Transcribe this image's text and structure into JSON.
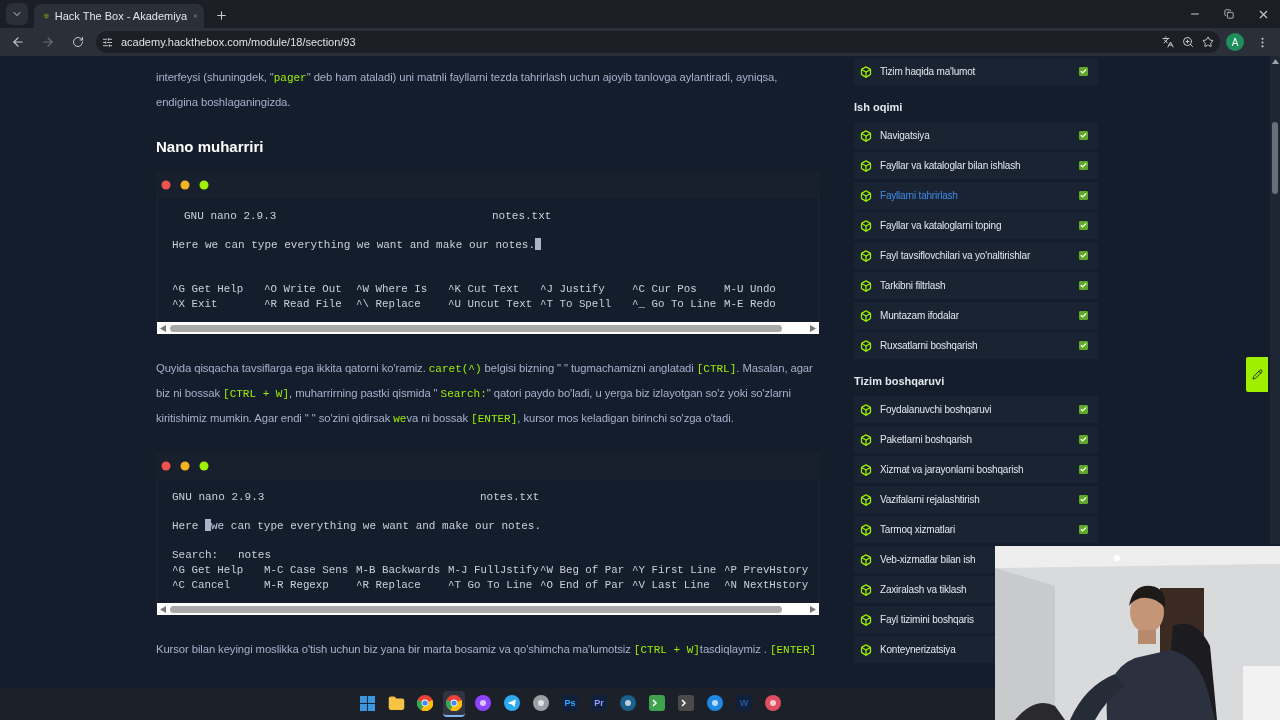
{
  "browser": {
    "tab": {
      "title": "Hack The Box - Akademiya",
      "selected": true
    },
    "url": "academy.hackthebox.com/module/18/section/93",
    "profile_initial": "A"
  },
  "article": [
    {
      "kind": "paragraph",
      "segments": [
        {
          "text": "interfeysi (shuningdek, \""
        },
        {
          "text": "pager",
          "kind": "code"
        },
        {
          "text": "\" deb ham ataladi) uni matnli fayllarni tezda tahrirlash uchun ajoyib tanlovga aylantiradi, ayniqsa, endigina boshlaganingizda."
        }
      ]
    },
    {
      "kind": "heading",
      "text": "Nano muharriri"
    },
    {
      "kind": "terminal",
      "lines": [
        {
          "kind": "title",
          "left": "GNU nano 2.9.3",
          "right": "notes.txt",
          "indented": true
        },
        {
          "kind": "text",
          "text": "Here we can type everything we want and make our notes.",
          "cursor": true
        },
        {
          "kind": "menu",
          "cells": [
            "^G Get Help",
            "^O Write Out",
            "^W Where Is",
            "^K Cut Text",
            "^J Justify",
            "^C Cur Pos",
            "M-U Undo"
          ]
        },
        {
          "kind": "menu",
          "cells": [
            "^X Exit",
            "^R Read File",
            "^\\ Replace",
            "^U Uncut Text",
            "^T To Spell",
            "^_ Go To Line",
            "M-E Redo"
          ]
        }
      ]
    },
    {
      "kind": "paragraph",
      "segments": [
        {
          "text": "Quyida qisqacha tavsiflarga ega ikkita qatorni ko'ramiz. "
        },
        {
          "text": "caret(^)",
          "kind": "code"
        },
        {
          "text": " belgisi bizning \" \" tugmachamizni anglatadi "
        },
        {
          "text": "[CTRL]",
          "kind": "code"
        },
        {
          "text": ". Masalan, agar biz ni bossak "
        },
        {
          "text": "[CTRL + W]",
          "kind": "code"
        },
        {
          "text": ", muharrirning pastki qismida \" "
        },
        {
          "text": "Search:",
          "kind": "code"
        },
        {
          "text": "\" qatori paydo bo'ladi, u yerga biz izlayotgan so'z yoki so'zlarni kiritishimiz mumkin. Agar endi \" \" so'zini qidirsak "
        },
        {
          "text": "we",
          "kind": "code"
        },
        {
          "text": "va ni bossak "
        },
        {
          "text": "[ENTER]",
          "kind": "code"
        },
        {
          "text": ", kursor mos keladigan birinchi so'zga o'tadi."
        }
      ]
    },
    {
      "kind": "terminal",
      "lines": [
        {
          "kind": "title",
          "left": "GNU nano 2.9.3",
          "right": "notes.txt",
          "indented": false
        },
        {
          "kind": "text",
          "text": "Here ",
          "cursor": true,
          "after": "we can type everything we want and make our notes."
        },
        {
          "kind": "search",
          "text": "Search:   notes"
        },
        {
          "kind": "menu",
          "cells": [
            "^G Get Help",
            "M-C Case Sens",
            "M-B Backwards",
            "M-J FullJstify",
            "^W Beg of Par",
            "^Y First Line",
            "^P PrevHstory"
          ]
        },
        {
          "kind": "menu",
          "cells": [
            "^C Cancel",
            "M-R Regexp",
            "^R Replace",
            "^T Go To Line",
            "^O End of Par",
            "^V Last Line",
            "^N NextHstory"
          ]
        }
      ]
    },
    {
      "kind": "paragraph",
      "segments": [
        {
          "text": "Kursor bilan keyingi moslikka o'tish uchun biz yana bir marta bosamiz va qo'shimcha ma'lumotsiz "
        },
        {
          "text": "[CTRL + W]",
          "kind": "code"
        },
        {
          "text": "tasdiqlaymiz . "
        },
        {
          "text": "[ENTER]",
          "kind": "code"
        }
      ]
    }
  ],
  "sidebar": {
    "sections": [
      {
        "items": [
          {
            "label": "Tizim haqida ma'lumot",
            "selected": false,
            "checked": true
          }
        ]
      },
      {
        "title": "Ish oqimi",
        "items": [
          {
            "label": "Navigatsiya",
            "selected": false,
            "checked": true
          },
          {
            "label": "Fayllar va kataloglar bilan ishlash",
            "selected": false,
            "checked": true
          },
          {
            "label": "Fayllarni tahrirlash",
            "selected": true,
            "checked": true
          },
          {
            "label": "Fayllar va kataloglarni toping",
            "selected": false,
            "checked": true
          },
          {
            "label": "Fayl tavsiflovchilari va yo'naltirishlar",
            "selected": false,
            "checked": true
          },
          {
            "label": "Tarkibni filtrlash",
            "selected": false,
            "checked": true
          },
          {
            "label": "Muntazam ifodalar",
            "selected": false,
            "checked": true
          },
          {
            "label": "Ruxsatlarni boshqarish",
            "selected": false,
            "checked": true
          }
        ]
      },
      {
        "title": "Tizim boshqaruvi",
        "items": [
          {
            "label": "Foydalanuvchi boshqaruvi",
            "selected": false,
            "checked": true
          },
          {
            "label": "Paketlarni boshqarish",
            "selected": false,
            "checked": true
          },
          {
            "label": "Xizmat va jarayonlarni boshqarish",
            "selected": false,
            "checked": true
          },
          {
            "label": "Vazifalarni rejalashtirish",
            "selected": false,
            "checked": true
          },
          {
            "label": "Tarmoq xizmatlari",
            "selected": false,
            "checked": true
          },
          {
            "label": "Veb-xizmatlar bilan ish",
            "selected": false
          },
          {
            "label": "Zaxiralash va tiklash",
            "selected": false
          },
          {
            "label": "Fayl tizimini boshqaris",
            "selected": false
          },
          {
            "label": "Konteynerizatsiya",
            "selected": false
          }
        ]
      }
    ]
  },
  "taskbar": [
    {
      "kind": "windows",
      "color": "#3a96dd",
      "selected": false
    },
    {
      "kind": "folder",
      "color": "#f6c344",
      "selected": false
    },
    {
      "kind": "browser",
      "color": "#34a853",
      "selected": false
    },
    {
      "kind": "browser",
      "color": "#34a853",
      "selected": true
    },
    {
      "kind": "disc",
      "color": "#8e44ff",
      "selected": false
    },
    {
      "kind": "send",
      "color": "#2aabee",
      "selected": false
    },
    {
      "kind": "disc",
      "color": "#9aa0a6",
      "selected": false
    },
    {
      "kind": "letters",
      "label": "Ps",
      "color": "#31a8ff",
      "selected": false
    },
    {
      "kind": "letters",
      "label": "Pr",
      "color": "#9999ff",
      "selected": false
    },
    {
      "kind": "disc",
      "color": "#1b5f8a",
      "selected": false
    },
    {
      "kind": "tile",
      "color": "#3fa34d",
      "selected": false
    },
    {
      "kind": "tile",
      "color": "#4a4a4a",
      "selected": false
    },
    {
      "kind": "disc",
      "color": "#1e88e5",
      "selected": false
    },
    {
      "kind": "letters",
      "label": "W",
      "color": "#2b579a",
      "selected": false
    },
    {
      "kind": "disc",
      "color": "#e04f5f",
      "selected": false
    }
  ]
}
